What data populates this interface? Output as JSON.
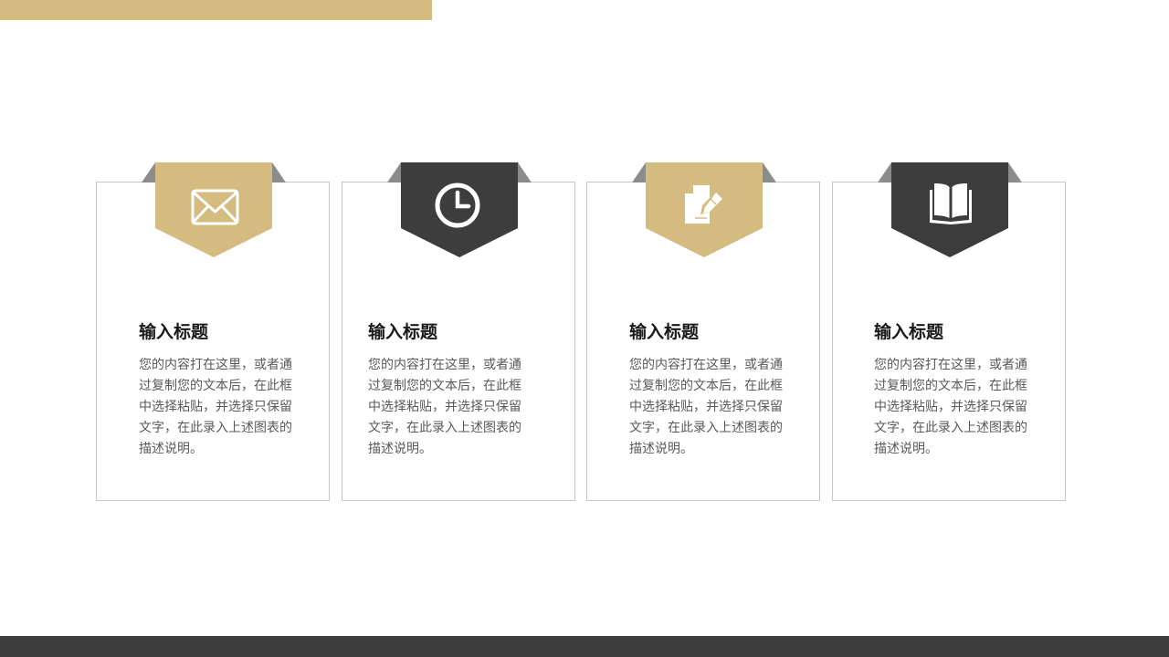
{
  "colors": {
    "accent_gold": "#d4bb80",
    "accent_dark": "#3d3d3d",
    "fold_gray": "#8c8c8c",
    "card_border": "#c6c6c6"
  },
  "cards": [
    {
      "icon": "envelope-icon",
      "ribbon_color": "gold",
      "title": "输入标题",
      "description": "您的内容打在这里，或者通过复制您的文本后，在此框中选择粘贴，并选择只保留文字，在此录入上述图表的描述说明。"
    },
    {
      "icon": "clock-icon",
      "ribbon_color": "dark",
      "title": "输入标题",
      "description": "您的内容打在这里，或者通过复制您的文本后，在此框中选择粘贴，并选择只保留文字，在此录入上述图表的描述说明。"
    },
    {
      "icon": "document-edit-icon",
      "ribbon_color": "gold",
      "title": "输入标题",
      "description": "您的内容打在这里，或者通过复制您的文本后，在此框中选择粘贴，并选择只保留文字，在此录入上述图表的描述说明。"
    },
    {
      "icon": "open-book-icon",
      "ribbon_color": "dark",
      "title": "输入标题",
      "description": "您的内容打在这里，或者通过复制您的文本后，在此框中选择粘贴，并选择只保留文字，在此录入上述图表的描述说明。"
    }
  ]
}
